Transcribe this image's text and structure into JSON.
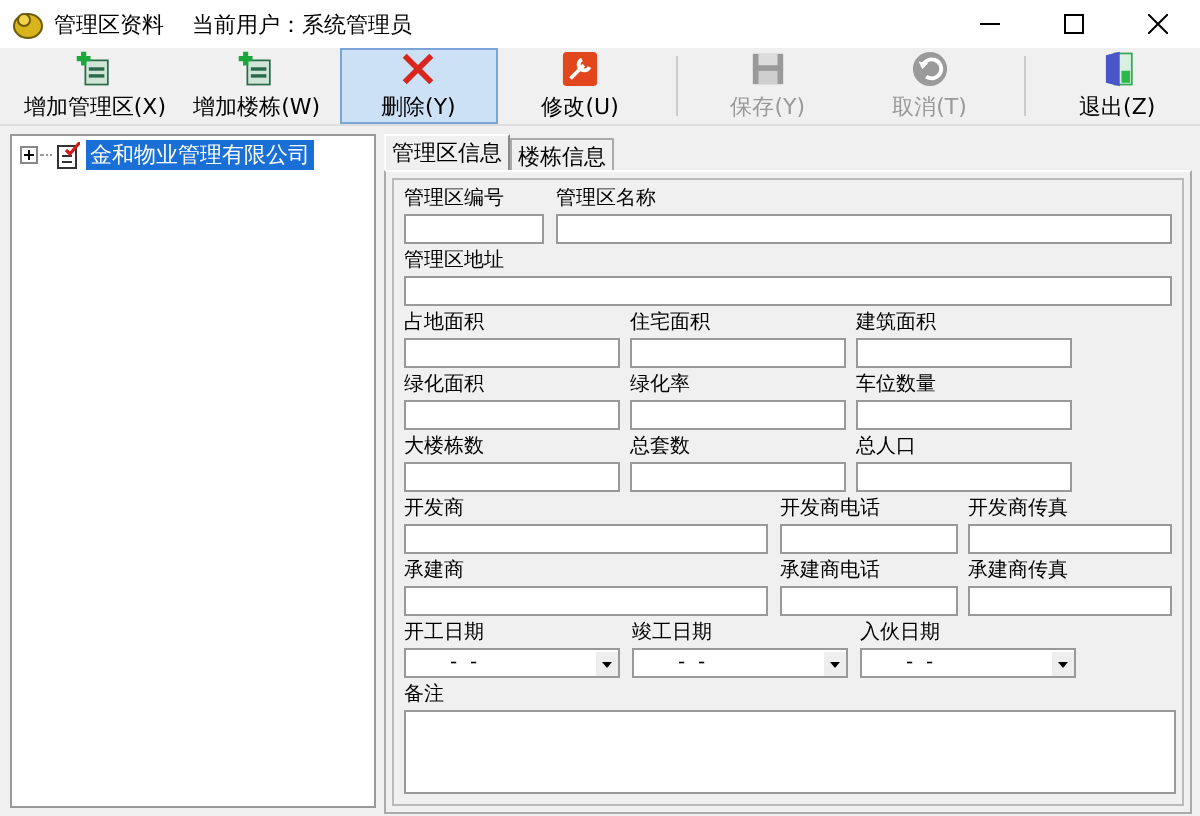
{
  "window": {
    "title": "管理区资料",
    "user": "当前用户：系统管理员"
  },
  "toolbar": [
    {
      "label": "增加管理区(X)",
      "kind": "add",
      "disabled": false,
      "highlighted": false
    },
    {
      "label": "增加楼栋(W)",
      "kind": "add",
      "disabled": false,
      "highlighted": false
    },
    {
      "label": "删除(Y)",
      "kind": "delete",
      "disabled": false,
      "highlighted": true
    },
    {
      "label": "修改(U)",
      "kind": "edit",
      "disabled": false,
      "highlighted": false
    },
    {
      "label": "保存(Y)",
      "kind": "save",
      "disabled": true,
      "highlighted": false
    },
    {
      "label": "取消(T)",
      "kind": "cancel",
      "disabled": true,
      "highlighted": false
    },
    {
      "label": "退出(Z)",
      "kind": "exit",
      "disabled": false,
      "highlighted": false
    }
  ],
  "tree": [
    {
      "label": "金和物业管理有限公司",
      "selected": true,
      "expanded": false
    }
  ],
  "tabs": [
    {
      "label": "管理区信息",
      "selected": true
    },
    {
      "label": "楼栋信息",
      "selected": false
    }
  ],
  "form_rows": [
    [
      {
        "label": "管理区编号",
        "kind": "text"
      },
      {
        "label": "管理区名称",
        "kind": "text"
      }
    ],
    [
      {
        "label": "管理区地址",
        "kind": "text"
      }
    ],
    [
      {
        "label": "占地面积",
        "kind": "text"
      },
      {
        "label": "住宅面积",
        "kind": "text"
      },
      {
        "label": "建筑面积",
        "kind": "text"
      }
    ],
    [
      {
        "label": "绿化面积",
        "kind": "text"
      },
      {
        "label": "绿化率",
        "kind": "text"
      },
      {
        "label": "车位数量",
        "kind": "text"
      }
    ],
    [
      {
        "label": "大楼栋数",
        "kind": "text"
      },
      {
        "label": "总套数",
        "kind": "text"
      },
      {
        "label": "总人口",
        "kind": "text"
      }
    ],
    [
      {
        "label": "开发商",
        "kind": "text"
      },
      {
        "label": "开发商电话",
        "kind": "text"
      },
      {
        "label": "开发商传真",
        "kind": "text"
      }
    ],
    [
      {
        "label": "承建商",
        "kind": "text"
      },
      {
        "label": "承建商电话",
        "kind": "text"
      },
      {
        "label": "承建商传真",
        "kind": "text"
      }
    ],
    [
      {
        "label": "开工日期",
        "kind": "date",
        "value": "-  -"
      },
      {
        "label": "竣工日期",
        "kind": "date",
        "value": "-  -"
      },
      {
        "label": "入伙日期",
        "kind": "date",
        "value": "-  -"
      }
    ],
    [
      {
        "label": "备注",
        "kind": "memo"
      }
    ]
  ]
}
